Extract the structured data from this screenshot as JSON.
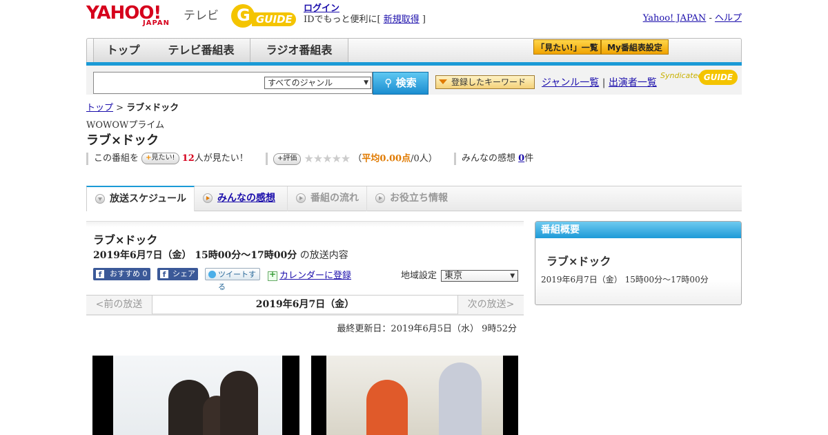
{
  "header": {
    "yahoo_logo": "YAHOO!",
    "yahoo_sub": "JAPAN",
    "tv_label": "テレビ",
    "gguide_label": "GUIDE",
    "login_link": "ログイン",
    "login_prefix": "IDでもっと便利に[ ",
    "register_link": "新規取得",
    "login_suffix": " ]",
    "yahoo_japan_link": "Yahoo! JAPAN",
    "separator": " - ",
    "help_link": "ヘルプ"
  },
  "nav": {
    "tabs": [
      "トップ",
      "テレビ番組表",
      "ラジオ番組表"
    ],
    "want_list_btn": "「見たい!」一覧",
    "my_guide_btn": "My番組表設定"
  },
  "search": {
    "genre_selected": "すべてのジャンル",
    "search_btn": "検索",
    "keyword_btn": "登録したキーワード",
    "genre_list_link": "ジャンル一覧",
    "divider": " | ",
    "cast_list_link": "出演者一覧",
    "syndicated": "Syndicated",
    "syn_logo": "GUIDE"
  },
  "breadcrumb": {
    "top": "トップ",
    "sep": " > ",
    "current": "ラブ×ドック"
  },
  "program": {
    "channel": "WOWOWプライム",
    "title": "ラブ×ドック",
    "this_program": "この番組を",
    "want_btn": "見たい!",
    "want_count": "12",
    "want_suffix": "人が見たい！",
    "rate_btn": "評価",
    "stars": "★★★★★",
    "avg_open": "（",
    "avg_label": "平均0.00点",
    "avg_count": "/0人）",
    "impressions_label": "みんなの感想 ",
    "impressions_count": "0",
    "impressions_suffix": "件"
  },
  "tabs": [
    {
      "label": "放送スケジュール"
    },
    {
      "label": "みんなの感想"
    },
    {
      "label": "番組の流れ"
    },
    {
      "label": "お役立ち情報"
    }
  ],
  "schedule": {
    "title": "ラブ×ドック",
    "datetime": "2019年6月7日（金）  15時00分～17時00分",
    "datetime_suffix": " の放送内容",
    "fb_recommend": "おすすめ 0",
    "fb_share": "シェア",
    "tweet": "ツイートする",
    "calendar": "カレンダーに登録",
    "region_label": "地域設定",
    "region_selected": "東京",
    "prev": "<前の放送",
    "current_day": "2019年6月7日（金）",
    "next": "次の放送>",
    "updated": "最終更新日：2019年6月5日（水）  9時52分"
  },
  "sidebar": {
    "heading": "番組概要",
    "title": "ラブ×ドック",
    "time": "2019年6月7日（金）  15時00分～17時00分"
  },
  "colors": {
    "brand_red": "#d6001c",
    "accent_blue": "#1a9ad6",
    "gguide_yellow": "#f4c400"
  }
}
